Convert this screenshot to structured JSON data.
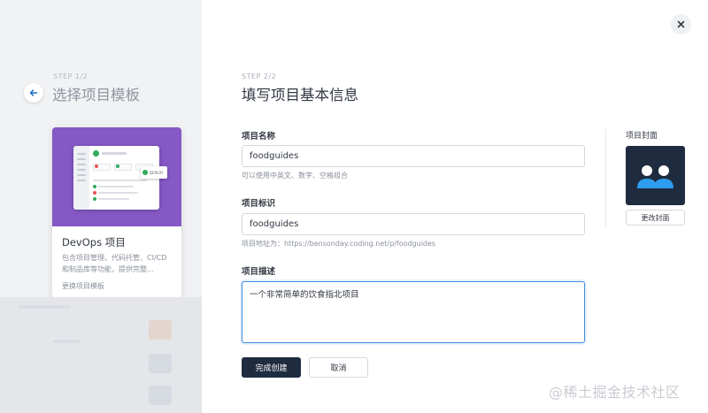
{
  "left_panel": {
    "step_label": "STEP 1/2",
    "title": "选择项目模板",
    "template_card": {
      "name": "DevOps 项目",
      "description": "包含项目管理、代码托管、CI/CD 和制品库等功能，提供完整...",
      "change_link": "更换项目模板",
      "banner_color": "#8558c5"
    }
  },
  "modal": {
    "step_label": "STEP 2/2",
    "title": "填写项目基本信息",
    "fields": {
      "name": {
        "label": "项目名称",
        "value": "foodguides",
        "hint": "可以使用中英文、数字、空格组合"
      },
      "identifier": {
        "label": "项目标识",
        "value": "foodguides",
        "hint": "项目地址为：https://bensonday.coding.net/p/foodguides"
      },
      "description": {
        "label": "项目描述",
        "value": "一个非常简单的饮食指北项目"
      }
    },
    "cover": {
      "label": "项目封面",
      "change_button": "更改封面",
      "background_color": "#1f2b3f",
      "avatar_color": "#2d9df0"
    },
    "buttons": {
      "submit": "完成创建",
      "cancel": "取消"
    },
    "close_icon": "close-icon"
  },
  "watermark": "@稀土掘金技术社区",
  "colors": {
    "primary": "#1f2b3f",
    "focus": "#3f8ede",
    "success": "#2faa5b"
  }
}
